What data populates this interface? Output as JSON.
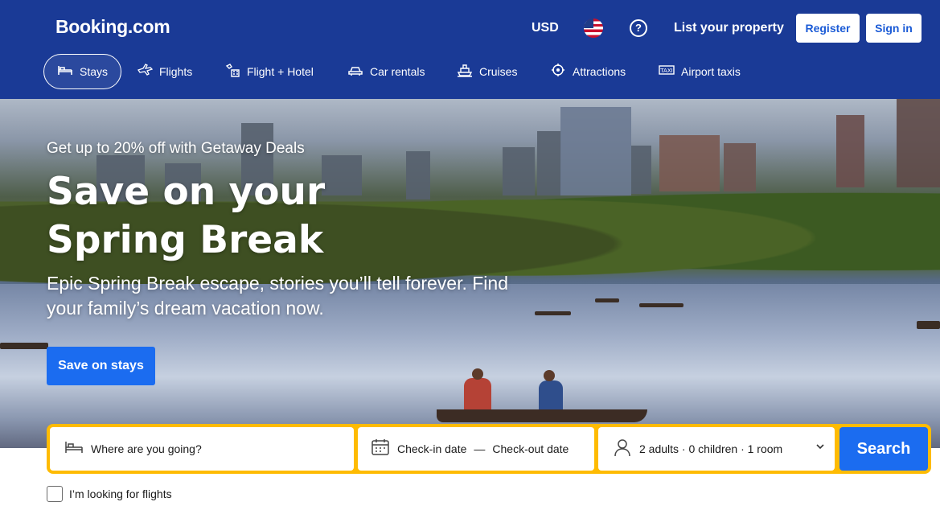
{
  "header": {
    "logo": "Booking.com",
    "currency": "USD",
    "help_icon": "?",
    "list_property": "List your property",
    "register": "Register",
    "sign_in": "Sign in"
  },
  "nav": {
    "items": [
      {
        "label": "Stays",
        "icon": "bed-icon"
      },
      {
        "label": "Flights",
        "icon": "plane-icon"
      },
      {
        "label": "Flight + Hotel",
        "icon": "flight-hotel-icon"
      },
      {
        "label": "Car rentals",
        "icon": "car-icon"
      },
      {
        "label": "Cruises",
        "icon": "ship-icon"
      },
      {
        "label": "Attractions",
        "icon": "attractions-icon"
      },
      {
        "label": "Airport taxis",
        "icon": "taxi-icon"
      }
    ]
  },
  "hero": {
    "eyebrow": "Get up to 20% off with Getaway Deals",
    "title": "Save on your Spring Break",
    "subtitle": "Epic Spring Break escape, stories you’ll tell forever. Find your family’s dream vacation now.",
    "cta": "Save on stays"
  },
  "search": {
    "destination_placeholder": "Where are you going?",
    "checkin": "Check-in date",
    "separator": "—",
    "checkout": "Check-out date",
    "guests": "2 adults · 0 children · 1 room",
    "button": "Search"
  },
  "flights_checkbox": {
    "label": "I’m looking for flights",
    "checked": false
  },
  "colors": {
    "header_bg": "#1a3a96",
    "accent_blue": "#1b6cf0",
    "search_border": "#febb02"
  }
}
